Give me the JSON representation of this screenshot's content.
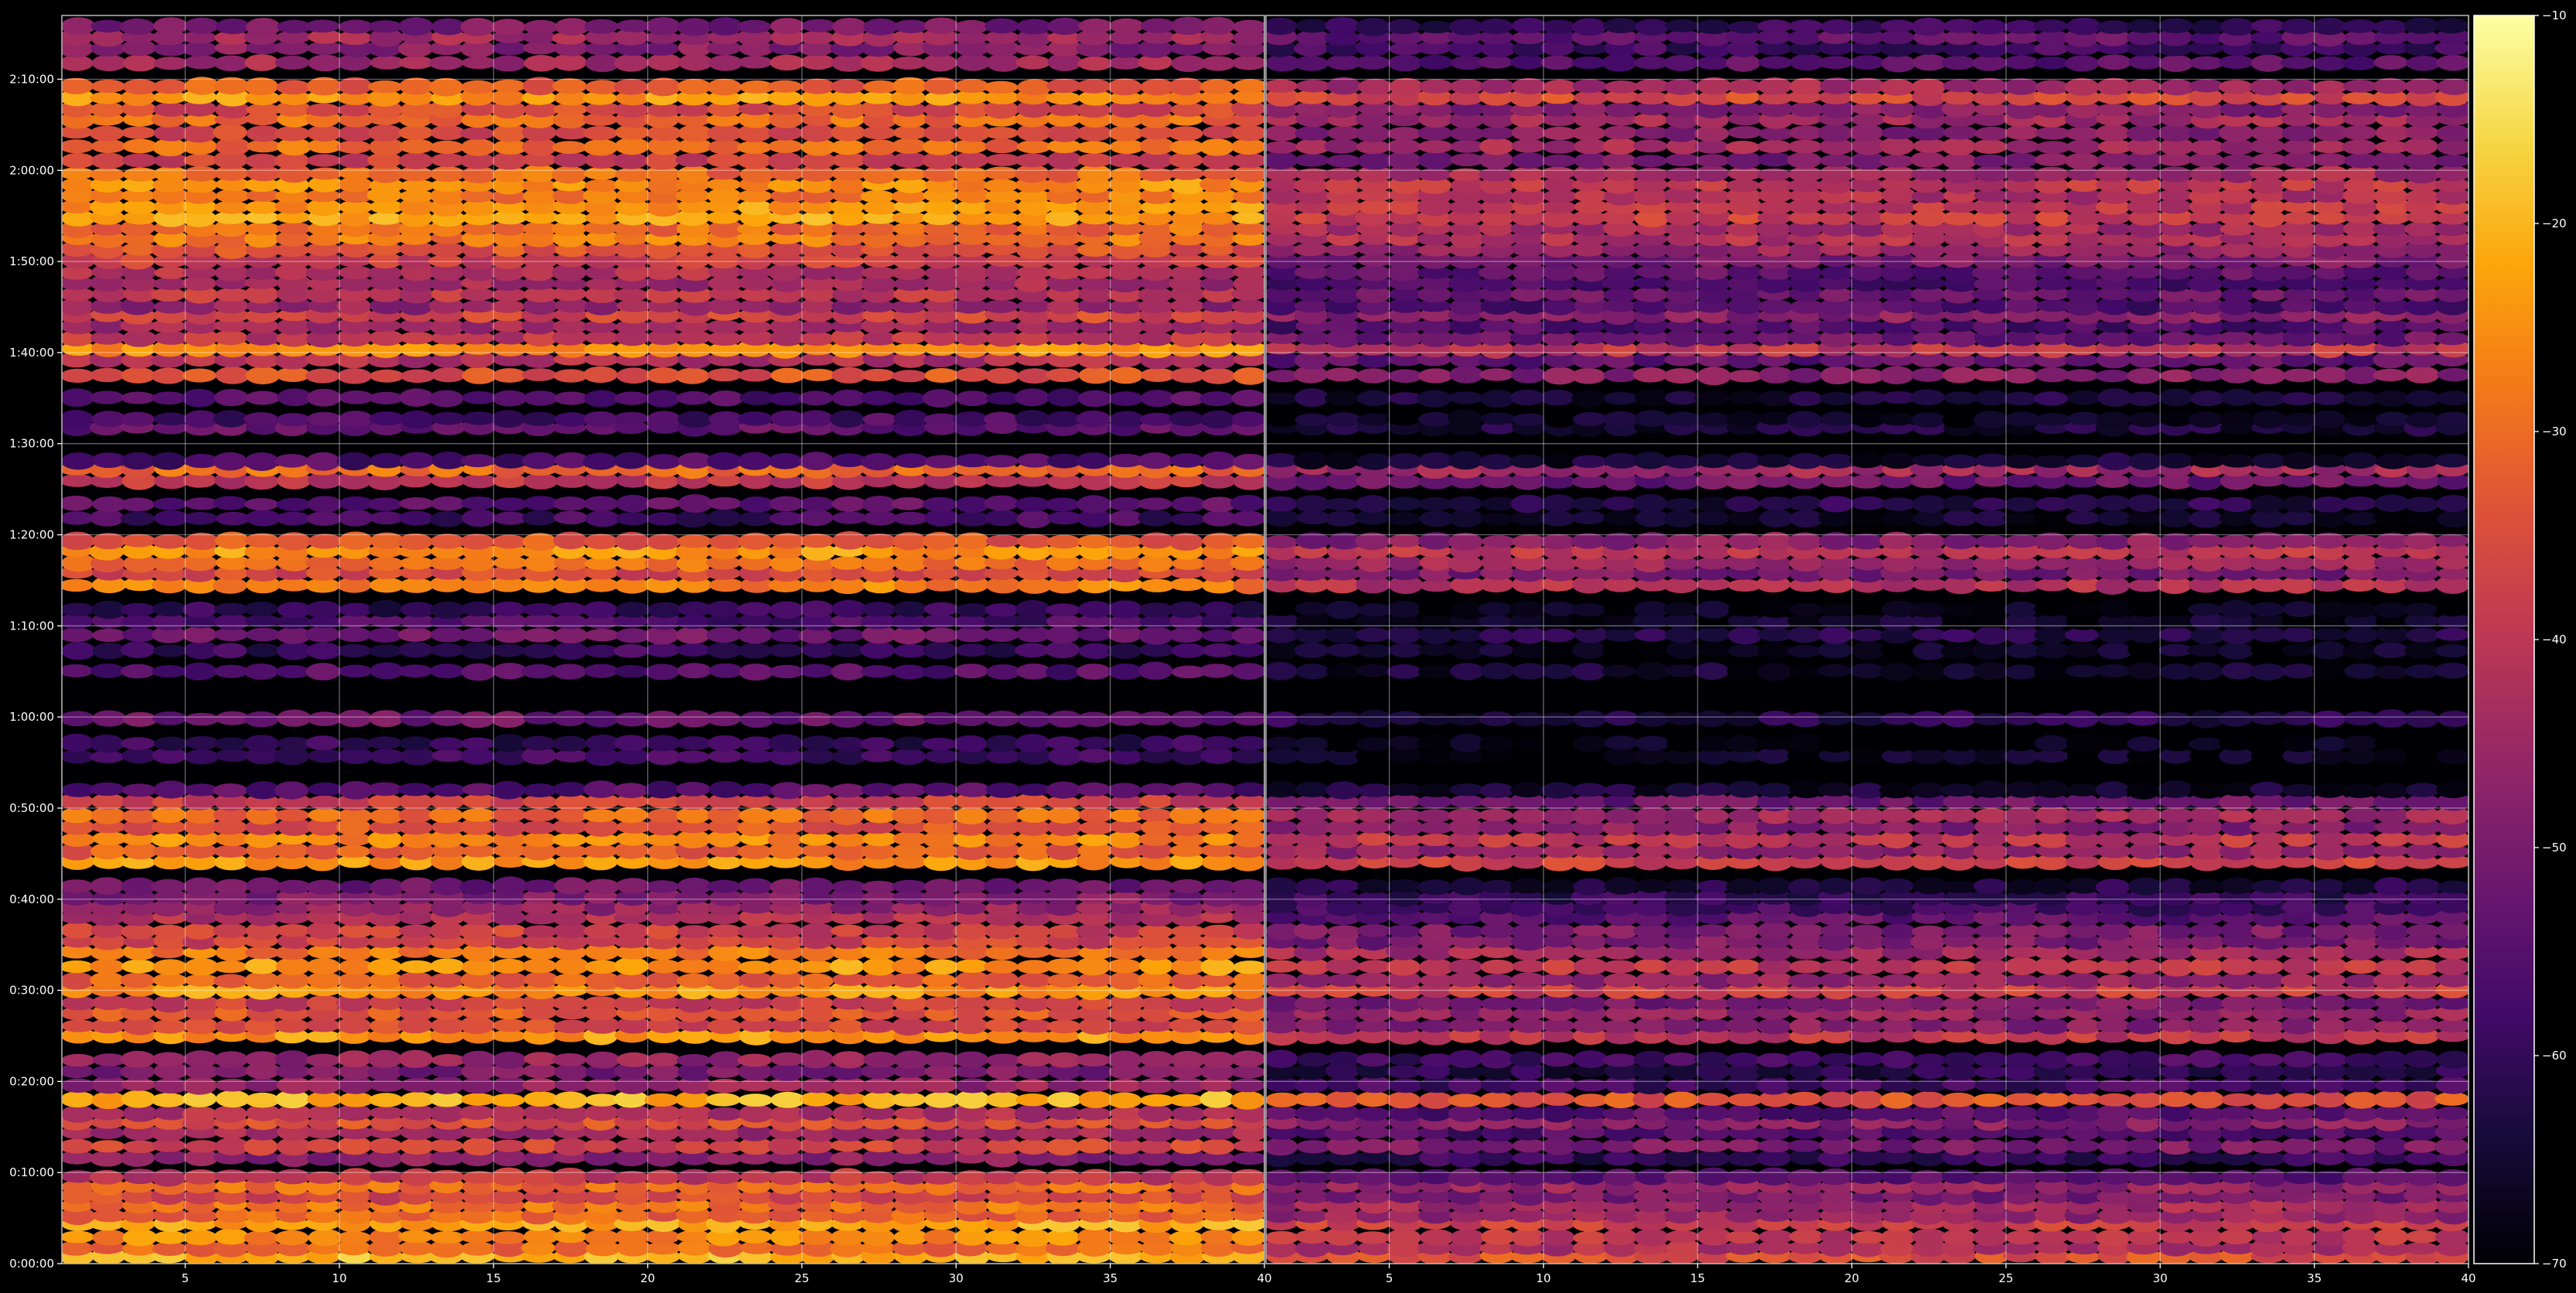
{
  "chart_data": {
    "type": "heatmap",
    "title": "",
    "xlabel": "",
    "ylabel": "",
    "colormap": "inferno",
    "background_color": "#000000",
    "grid": true,
    "grid_color": "#ffffff",
    "colorbar": {
      "position": "right",
      "range": [
        -70,
        -10
      ],
      "ticks": [
        -10,
        -20,
        -30,
        -40,
        -50,
        -60,
        -70
      ],
      "tick_labels": [
        "−10",
        "−20",
        "−30",
        "−40",
        "−50",
        "−60",
        "−70"
      ]
    },
    "y_axis": {
      "range_minutes": [
        0,
        137
      ],
      "ticks_minutes": [
        0,
        10,
        20,
        30,
        40,
        50,
        60,
        70,
        80,
        90,
        100,
        110,
        120,
        130
      ],
      "tick_labels": [
        "0:00:00",
        "0:10:00",
        "0:20:00",
        "0:30:00",
        "0:40:00",
        "0:50:00",
        "1:00:00",
        "1:10:00",
        "1:20:00",
        "1:30:00",
        "1:40:00",
        "1:50:00",
        "2:00:00",
        "2:10:00"
      ]
    },
    "x_axis": {
      "range": [
        1,
        40
      ],
      "ticks": [
        5,
        10,
        15,
        20,
        25,
        30,
        35,
        40
      ],
      "tick_labels": [
        "5",
        "10",
        "15",
        "20",
        "25",
        "30",
        "35",
        "40"
      ]
    },
    "panels": [
      {
        "name": "left",
        "bands": [
          {
            "t": 0.8,
            "v": -20
          },
          {
            "t": 1.7,
            "v": -30
          },
          {
            "t": 2.9,
            "v": -26
          },
          {
            "t": 4.4,
            "v": -22
          },
          {
            "t": 5.3,
            "v": -31
          },
          {
            "t": 6.4,
            "v": -29
          },
          {
            "t": 7.4,
            "v": -36
          },
          {
            "t": 8.5,
            "v": -30
          },
          {
            "t": 9.5,
            "v": -40
          },
          {
            "t": 11.6,
            "v": -48
          },
          {
            "t": 12.9,
            "v": -37
          },
          {
            "t": 14.4,
            "v": -44
          },
          {
            "t": 15.5,
            "v": -35
          },
          {
            "t": 16.5,
            "v": -42
          },
          {
            "t": 18.0,
            "v": -21
          },
          {
            "t": 19.6,
            "v": -46
          },
          {
            "t": 21.1,
            "v": -50
          },
          {
            "t": 22.4,
            "v": -46
          },
          {
            "t": 25.0,
            "v": -24
          },
          {
            "t": 26.1,
            "v": -36
          },
          {
            "t": 27.5,
            "v": -33
          },
          {
            "t": 28.6,
            "v": -38
          },
          {
            "t": 30.0,
            "v": -24
          },
          {
            "t": 31.1,
            "v": -32
          },
          {
            "t": 32.6,
            "v": -24
          },
          {
            "t": 34.2,
            "v": -28
          },
          {
            "t": 35.4,
            "v": -37
          },
          {
            "t": 36.5,
            "v": -38
          },
          {
            "t": 38.0,
            "v": -42
          },
          {
            "t": 39.1,
            "v": -46
          },
          {
            "t": 40.2,
            "v": -49
          },
          {
            "t": 41.4,
            "v": -52
          },
          {
            "t": 44.1,
            "v": -24
          },
          {
            "t": 45.3,
            "v": -32
          },
          {
            "t": 46.6,
            "v": -26
          },
          {
            "t": 47.9,
            "v": -34
          },
          {
            "t": 49.2,
            "v": -30
          },
          {
            "t": 50.7,
            "v": -38
          },
          {
            "t": 52.0,
            "v": -55
          },
          {
            "t": 55.7,
            "v": -58
          },
          {
            "t": 57.1,
            "v": -60
          },
          {
            "t": 59.8,
            "v": -52
          },
          {
            "t": 65.0,
            "v": -55
          },
          {
            "t": 67.3,
            "v": -59
          },
          {
            "t": 69.0,
            "v": -52
          },
          {
            "t": 70.5,
            "v": -57
          },
          {
            "t": 71.8,
            "v": -60
          },
          {
            "t": 74.5,
            "v": -27
          },
          {
            "t": 75.8,
            "v": -36
          },
          {
            "t": 76.9,
            "v": -30
          },
          {
            "t": 78.2,
            "v": -24
          },
          {
            "t": 79.3,
            "v": -33
          },
          {
            "t": 81.8,
            "v": -58
          },
          {
            "t": 83.4,
            "v": -54
          },
          {
            "t": 85.9,
            "v": -40
          },
          {
            "t": 87.2,
            "v": -30
          },
          {
            "t": 88.1,
            "v": -56
          },
          {
            "t": 91.8,
            "v": -54
          },
          {
            "t": 92.7,
            "v": -57
          },
          {
            "t": 95.0,
            "v": -56
          },
          {
            "t": 97.5,
            "v": -34
          },
          {
            "t": 99.2,
            "v": -42
          },
          {
            "t": 100.4,
            "v": -24
          },
          {
            "t": 101.6,
            "v": -40
          },
          {
            "t": 102.9,
            "v": -44
          },
          {
            "t": 104.1,
            "v": -36
          },
          {
            "t": 105.1,
            "v": -46
          },
          {
            "t": 106.4,
            "v": -40
          },
          {
            "t": 107.6,
            "v": -44
          },
          {
            "t": 108.8,
            "v": -42
          },
          {
            "t": 110.1,
            "v": -38
          },
          {
            "t": 111.3,
            "v": -34
          },
          {
            "t": 112.5,
            "v": -28
          },
          {
            "t": 113.6,
            "v": -30
          },
          {
            "t": 114.8,
            "v": -22
          },
          {
            "t": 116.0,
            "v": -24
          },
          {
            "t": 117.2,
            "v": -28
          },
          {
            "t": 118.4,
            "v": -25
          },
          {
            "t": 119.6,
            "v": -30
          },
          {
            "t": 121.1,
            "v": -38
          },
          {
            "t": 122.6,
            "v": -30
          },
          {
            "t": 124.1,
            "v": -36
          },
          {
            "t": 125.6,
            "v": -30
          },
          {
            "t": 126.7,
            "v": -36
          },
          {
            "t": 128.0,
            "v": -24
          },
          {
            "t": 129.2,
            "v": -32
          },
          {
            "t": 131.8,
            "v": -44
          },
          {
            "t": 133.4,
            "v": -48
          },
          {
            "t": 134.6,
            "v": -44
          },
          {
            "t": 135.8,
            "v": -50
          }
        ]
      },
      {
        "name": "right",
        "bands": [
          {
            "t": 0.8,
            "v": -34
          },
          {
            "t": 1.7,
            "v": -42
          },
          {
            "t": 2.9,
            "v": -40
          },
          {
            "t": 4.4,
            "v": -38
          },
          {
            "t": 5.3,
            "v": -46
          },
          {
            "t": 6.4,
            "v": -44
          },
          {
            "t": 7.4,
            "v": -50
          },
          {
            "t": 8.5,
            "v": -46
          },
          {
            "t": 9.5,
            "v": -54
          },
          {
            "t": 11.6,
            "v": -60
          },
          {
            "t": 12.9,
            "v": -50
          },
          {
            "t": 14.4,
            "v": -56
          },
          {
            "t": 15.5,
            "v": -48
          },
          {
            "t": 16.5,
            "v": -55
          },
          {
            "t": 18.0,
            "v": -34
          },
          {
            "t": 19.6,
            "v": -58
          },
          {
            "t": 21.1,
            "v": -62
          },
          {
            "t": 22.4,
            "v": -58
          },
          {
            "t": 25.0,
            "v": -40
          },
          {
            "t": 26.1,
            "v": -48
          },
          {
            "t": 27.5,
            "v": -46
          },
          {
            "t": 28.6,
            "v": -50
          },
          {
            "t": 30.0,
            "v": -38
          },
          {
            "t": 31.1,
            "v": -46
          },
          {
            "t": 32.6,
            "v": -40
          },
          {
            "t": 34.2,
            "v": -44
          },
          {
            "t": 35.4,
            "v": -50
          },
          {
            "t": 36.5,
            "v": -50
          },
          {
            "t": 38.0,
            "v": -54
          },
          {
            "t": 39.1,
            "v": -58
          },
          {
            "t": 40.2,
            "v": -60
          },
          {
            "t": 41.4,
            "v": -63
          },
          {
            "t": 44.1,
            "v": -38
          },
          {
            "t": 45.3,
            "v": -46
          },
          {
            "t": 46.6,
            "v": -40
          },
          {
            "t": 47.9,
            "v": -48
          },
          {
            "t": 49.2,
            "v": -44
          },
          {
            "t": 50.7,
            "v": -52
          },
          {
            "t": 52.0,
            "v": -65
          },
          {
            "t": 55.7,
            "v": -67
          },
          {
            "t": 57.1,
            "v": -68
          },
          {
            "t": 59.8,
            "v": -62
          },
          {
            "t": 65.0,
            "v": -65
          },
          {
            "t": 67.3,
            "v": -67
          },
          {
            "t": 69.0,
            "v": -62
          },
          {
            "t": 70.5,
            "v": -66
          },
          {
            "t": 71.8,
            "v": -68
          },
          {
            "t": 74.5,
            "v": -42
          },
          {
            "t": 75.8,
            "v": -50
          },
          {
            "t": 76.9,
            "v": -44
          },
          {
            "t": 78.2,
            "v": -40
          },
          {
            "t": 79.3,
            "v": -48
          },
          {
            "t": 81.8,
            "v": -66
          },
          {
            "t": 83.4,
            "v": -62
          },
          {
            "t": 85.9,
            "v": -52
          },
          {
            "t": 87.2,
            "v": -44
          },
          {
            "t": 88.1,
            "v": -65
          },
          {
            "t": 91.8,
            "v": -64
          },
          {
            "t": 92.7,
            "v": -66
          },
          {
            "t": 95.0,
            "v": -64
          },
          {
            "t": 97.5,
            "v": -48
          },
          {
            "t": 99.2,
            "v": -54
          },
          {
            "t": 100.4,
            "v": -40
          },
          {
            "t": 101.6,
            "v": -52
          },
          {
            "t": 102.9,
            "v": -56
          },
          {
            "t": 104.1,
            "v": -48
          },
          {
            "t": 105.1,
            "v": -56
          },
          {
            "t": 106.4,
            "v": -52
          },
          {
            "t": 107.6,
            "v": -56
          },
          {
            "t": 108.8,
            "v": -54
          },
          {
            "t": 110.1,
            "v": -50
          },
          {
            "t": 111.3,
            "v": -46
          },
          {
            "t": 112.5,
            "v": -42
          },
          {
            "t": 113.6,
            "v": -44
          },
          {
            "t": 114.8,
            "v": -38
          },
          {
            "t": 116.0,
            "v": -40
          },
          {
            "t": 117.2,
            "v": -42
          },
          {
            "t": 118.4,
            "v": -40
          },
          {
            "t": 119.6,
            "v": -44
          },
          {
            "t": 121.1,
            "v": -50
          },
          {
            "t": 122.6,
            "v": -44
          },
          {
            "t": 124.1,
            "v": -48
          },
          {
            "t": 125.6,
            "v": -44
          },
          {
            "t": 126.7,
            "v": -48
          },
          {
            "t": 128.0,
            "v": -36
          },
          {
            "t": 129.2,
            "v": -44
          },
          {
            "t": 131.8,
            "v": -54
          },
          {
            "t": 133.4,
            "v": -58
          },
          {
            "t": 134.6,
            "v": -54
          },
          {
            "t": 135.8,
            "v": -60
          }
        ]
      }
    ]
  }
}
